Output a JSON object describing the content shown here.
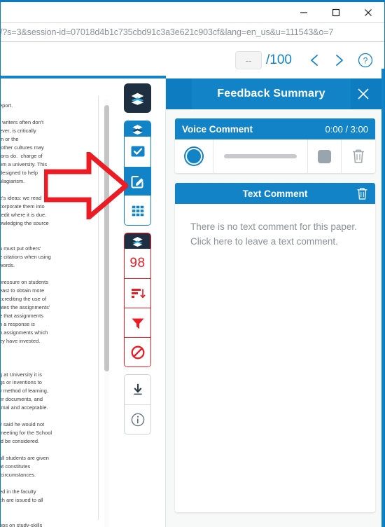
{
  "window": {
    "minimize_label": "Minimize",
    "maximize_label": "Maximize",
    "close_label": "Close"
  },
  "address_bar": {
    "url": "/?s=3&session-id=07018d4b1c735cbd91c3a3e621c903cf&lang=en_us&u=111543&o=7"
  },
  "app_toolbar": {
    "grade_value": "--",
    "grade_total": "/100",
    "prev_label": "Previous",
    "next_label": "Next",
    "help_label": "Help"
  },
  "document": {
    "body_text": "eport.\n\nt writers often don't\never, is critically\nm or the\n other cultures may\nions do.  charge of\nom a university. This\ndesigned to help\nplagiarism.\n\ne's ideas: we read\ncorporate them into\nredit where it is due.\nowledging the source\n\n\nu must put others'\ne citations when using\nwords.\n\noressure on students\neast to obtain more\nccrediting the use of\nates the assignments'\ne that assignments\nn a response is\nn assignments which\ney have invested.\n\n\n\ng at University it is\ngs or inventions to\ny method of learning,\ner documents, and\nrmal and acceptable.\n\ny said he would not\nmeeting for the School\nld be considered.\n\nall students are given\nat constitutes\n circumstances.\n\ned in the faculty\nch are issued to all\n\n\nops on study-skills"
  },
  "toolbar_rail": {
    "groups": [
      {
        "name": "instructor-feedback-group",
        "header_icon": "layers-icon",
        "items": []
      },
      {
        "name": "grading-tools-group",
        "header_icon": "layers-icon",
        "items": [
          {
            "icon": "checkbox-rubric-icon",
            "label": "Rubric / QuickMarks",
            "active": false
          },
          {
            "icon": "edit-comment-icon",
            "label": "Feedback Summary",
            "active": true
          },
          {
            "icon": "grid-quickmarks-icon",
            "label": "QuickMarks",
            "active": false
          }
        ]
      },
      {
        "name": "similarity-group",
        "header_icon": "layers-icon",
        "score": "98",
        "items": [
          {
            "icon": "match-overview-icon",
            "label": "Match Overview",
            "active": false
          },
          {
            "icon": "filter-icon",
            "label": "Filters and Settings",
            "active": false
          },
          {
            "icon": "exclude-icon",
            "label": "Excluded Sources",
            "active": false
          }
        ]
      },
      {
        "name": "utility-group",
        "items": [
          {
            "icon": "download-icon",
            "label": "Download",
            "active": false
          },
          {
            "icon": "info-icon",
            "label": "Submission Information",
            "active": false
          }
        ]
      }
    ]
  },
  "annotation": {
    "arrow_color": "#ec1c24",
    "arrow_label": "red-pointer-arrow"
  },
  "feedback_panel": {
    "title": "Feedback Summary",
    "close_label": "Close panel",
    "voice_comment": {
      "title": "Voice Comment",
      "time": "0:00 / 3:00",
      "record_label": "Record",
      "stop_label": "Stop",
      "delete_label": "Delete voice comment"
    },
    "text_comment": {
      "title": "Text Comment",
      "delete_label": "Delete text comment",
      "empty_message": "There is no text comment for this paper. Click here to leave a text comment."
    }
  },
  "colors": {
    "brand_blue": "#1183c6",
    "dark_navy": "#1e2f42",
    "alert_red": "#ed1c24",
    "panel_bg": "#f7f8f8"
  }
}
